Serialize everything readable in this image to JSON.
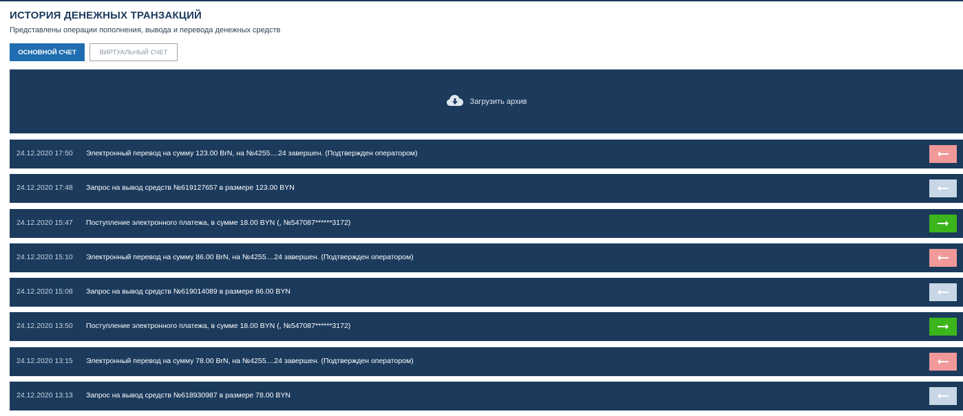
{
  "header": {
    "title": "ИСТОРИЯ ДЕНЕЖНЫХ ТРАНЗАКЦИЙ",
    "subtitle": "Представлены операции пополнения, вывода и перевода денежных средств"
  },
  "tabs": [
    {
      "label": "ОСНОВНОЙ СЧЕТ",
      "active": true
    },
    {
      "label": "ВИРТУАЛЬНЫЙ СЧЕТ",
      "active": false
    }
  ],
  "archive": {
    "label": "Загрузить архив",
    "icon": "cloud-download-icon"
  },
  "colors": {
    "panel": "#1b3a5c",
    "tab_active": "#1f6db0",
    "outgoing": "#f19999",
    "pending": "#c8d7e5",
    "incoming": "#3bb51b"
  },
  "transactions": [
    {
      "date": "24.12.2020 17:50",
      "description": "Электронный перевод на сумму 123.00 BrN, на №4255....24 завершен. (Подтвержден оператором)",
      "direction": "outgoing",
      "icon": "arrow-left-icon"
    },
    {
      "date": "24.12.2020 17:48",
      "description": "Запрос на вывод средств №619127657 в размере 123.00 BYN",
      "direction": "pending",
      "icon": "arrow-left-icon"
    },
    {
      "date": "24.12.2020 15:47",
      "description": "Поступление электронного платежа, в сумме 18.00 BYN (, №547087******3172)",
      "direction": "incoming",
      "icon": "arrow-right-icon"
    },
    {
      "date": "24.12.2020 15:10",
      "description": "Электронный перевод на сумму 86.00 BrN, на №4255....24 завершен. (Подтвержден оператором)",
      "direction": "outgoing",
      "icon": "arrow-left-icon"
    },
    {
      "date": "24.12.2020 15:08",
      "description": "Запрос на вывод средств №619014089 в размере 86.00 BYN",
      "direction": "pending",
      "icon": "arrow-left-icon"
    },
    {
      "date": "24.12.2020 13:50",
      "description": "Поступление электронного платежа, в сумме 18.00 BYN (, №547087******3172)",
      "direction": "incoming",
      "icon": "arrow-right-icon"
    },
    {
      "date": "24.12.2020 13:15",
      "description": "Электронный перевод на сумму 78.00 BrN, на №4255....24 завершен. (Подтвержден оператором)",
      "direction": "outgoing",
      "icon": "arrow-left-icon"
    },
    {
      "date": "24.12.2020 13:13",
      "description": "Запрос на вывод средств №618930987 в размере 78.00 BYN",
      "direction": "pending",
      "icon": "arrow-left-icon"
    }
  ]
}
